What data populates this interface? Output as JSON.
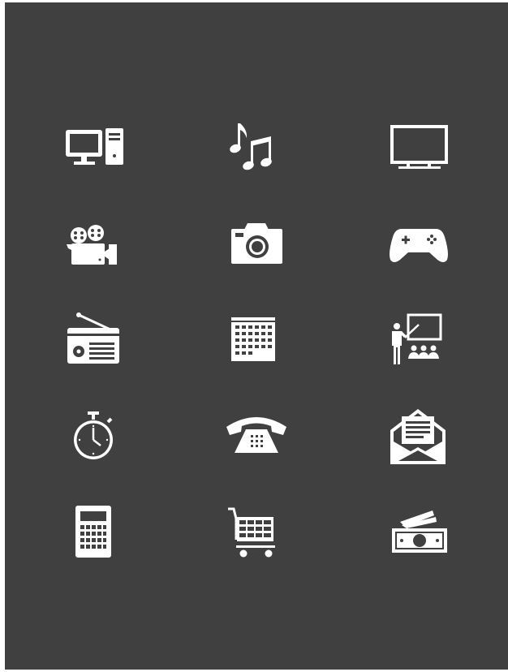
{
  "panel": {
    "background": "#404040",
    "icon_color": "#ffffff"
  },
  "icons": [
    "desktop-computer-icon",
    "music-notes-icon",
    "television-icon",
    "film-camera-icon",
    "photo-camera-icon",
    "gamepad-icon",
    "radio-icon",
    "calendar-icon",
    "presentation-teacher-icon",
    "stopwatch-icon",
    "telephone-icon",
    "envelope-letter-icon",
    "calculator-icon",
    "shopping-cart-icon",
    "cash-money-icon"
  ]
}
